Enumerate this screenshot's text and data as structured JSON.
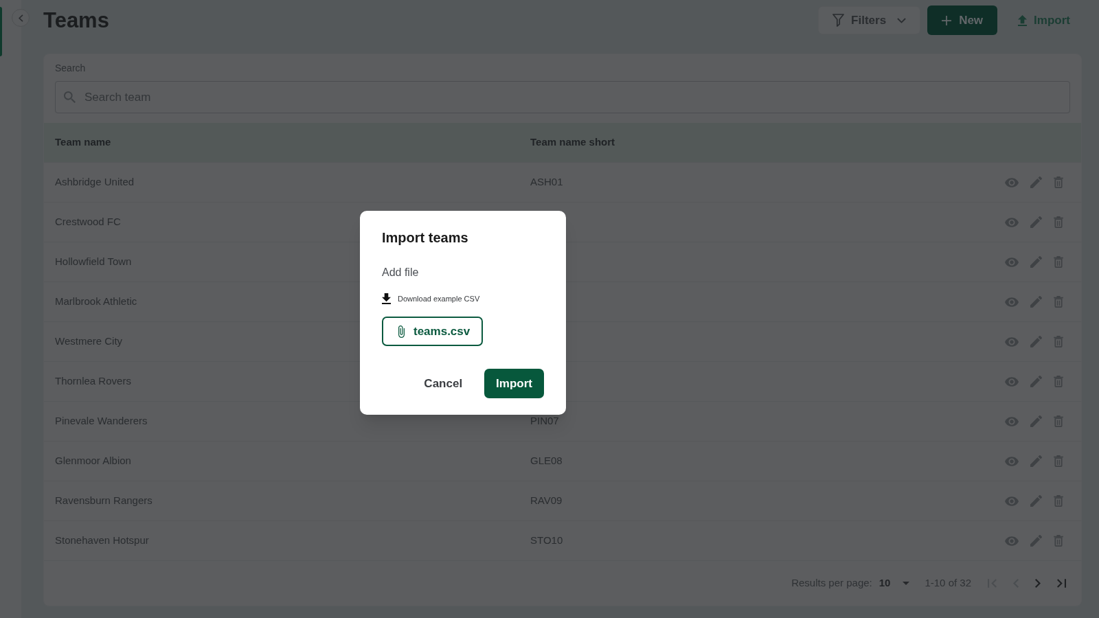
{
  "header": {
    "title": "Teams",
    "actions": [
      {
        "label": "Filters",
        "kind": "dropdown"
      },
      {
        "label": "New",
        "kind": "primary"
      },
      {
        "label": "Import",
        "kind": "link"
      }
    ]
  },
  "search": {
    "label": "Search",
    "placeholder": "Search team"
  },
  "table": {
    "columns": [
      "Team name",
      "Team name short"
    ],
    "rows": [
      {
        "name": "Ashbridge United",
        "short": "ASH01"
      },
      {
        "name": "Crestwood FC"
      },
      {
        "name": "Hollowfield Town"
      },
      {
        "name": "Marlbrook Athletic"
      },
      {
        "name": "Westmere City"
      },
      {
        "name": "Thornlea Rovers"
      },
      {
        "name": "Pinevale Wanderers",
        "short": "PIN07"
      },
      {
        "name": "Glenmoor Albion",
        "short": "GLE08"
      },
      {
        "name": "Ravensburn Rangers",
        "short": "RAV09"
      },
      {
        "name": "Stonehaven Hotspur",
        "short": "STO10"
      }
    ]
  },
  "pagination": {
    "label": "Results per page:",
    "per_page": "10",
    "range": "1-10 of 32",
    "buttons": [
      {
        "kind": "first",
        "disabled": true
      },
      {
        "kind": "prev",
        "disabled": true
      },
      {
        "kind": "next",
        "disabled": false
      },
      {
        "kind": "last",
        "disabled": false
      }
    ]
  },
  "dialog": {
    "title": "Import teams",
    "section_label": "Add file",
    "download_link": "Download example CSV",
    "file_name": "teams.csv",
    "buttons": [
      {
        "label": "Cancel",
        "kind": "secondary"
      },
      {
        "label": "Import",
        "kind": "primary"
      }
    ]
  }
}
